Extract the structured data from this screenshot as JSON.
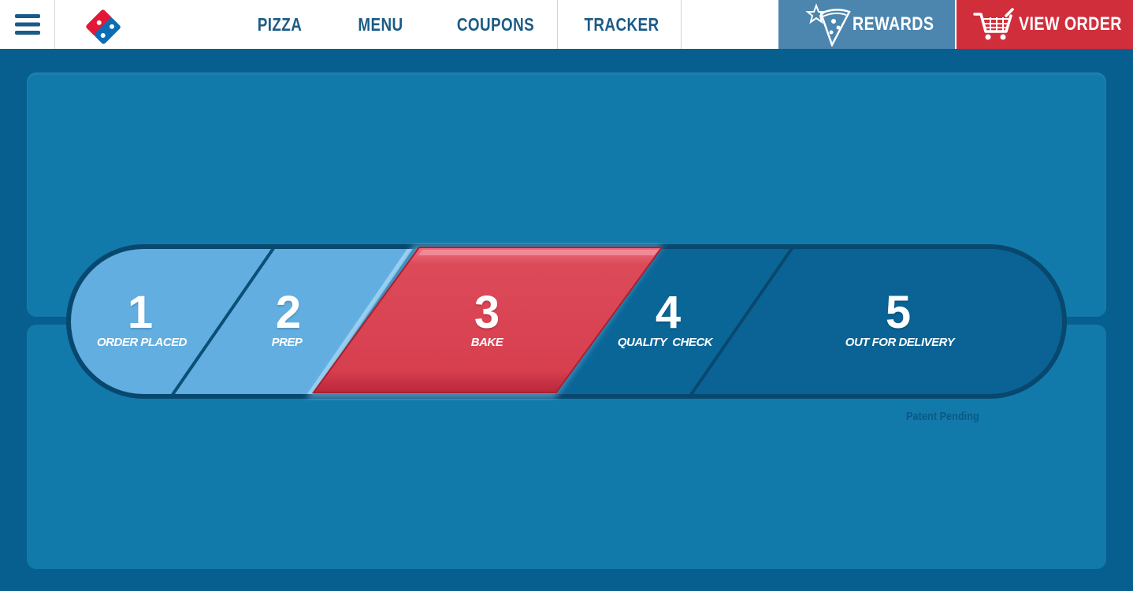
{
  "nav": {
    "menu_icon": "hamburger-icon",
    "logo": "dominos-logo",
    "items": [
      {
        "label": "PIZZA"
      },
      {
        "label": "MENU"
      },
      {
        "label": "COUPONS"
      },
      {
        "label": "TRACKER"
      }
    ],
    "rewards": {
      "label": "REWARDS",
      "icon": "star-pizza-icon"
    },
    "view_order": {
      "label": "VIEW ORDER",
      "icon": "cart-icon"
    }
  },
  "tracker": {
    "current_step": 3,
    "steps": [
      {
        "number": "1",
        "label": "ORDER PLACED"
      },
      {
        "number": "2",
        "label": "PREP"
      },
      {
        "number": "3",
        "label": "BAKE"
      },
      {
        "number": "4",
        "label": "QUALITY  CHECK"
      },
      {
        "number": "5",
        "label": "OUT FOR DELIVERY"
      }
    ],
    "colors": {
      "completed": "#62aee0",
      "active": "#d94a58",
      "pending": "#0a6394",
      "outline": "#08486e"
    }
  },
  "footer_note": "Patent Pending"
}
